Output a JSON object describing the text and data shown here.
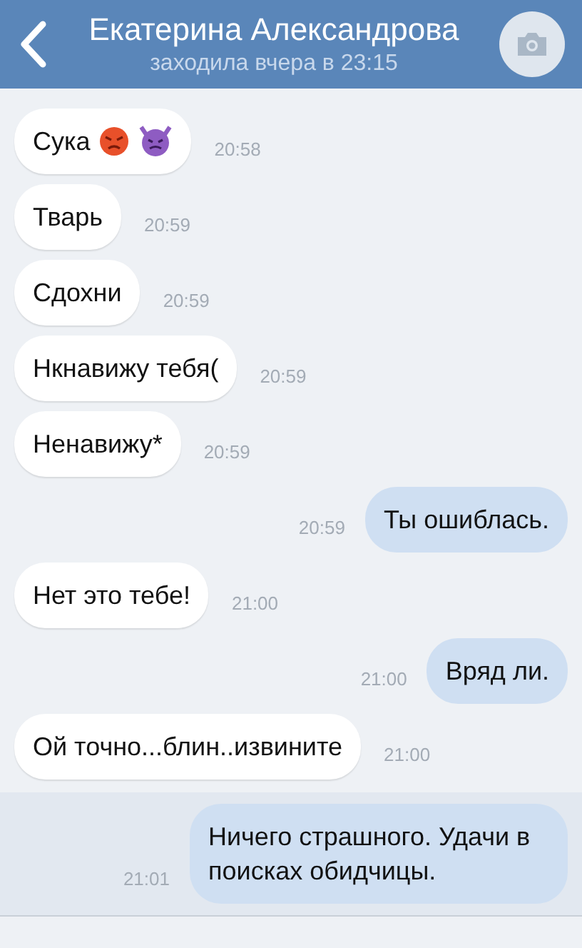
{
  "header": {
    "title": "Екатерина Александрова",
    "status": "заходила вчера в 23:15"
  },
  "messages": [
    {
      "kind": "incoming_emoji",
      "text": "Сука",
      "time": "20:58",
      "unread": false
    },
    {
      "kind": "incoming",
      "text": "Тварь",
      "time": "20:59",
      "unread": false
    },
    {
      "kind": "incoming",
      "text": "Сдохни",
      "time": "20:59",
      "unread": false
    },
    {
      "kind": "incoming",
      "text": "Нкнавижу тебя(",
      "time": "20:59",
      "unread": false
    },
    {
      "kind": "incoming",
      "text": "Ненавижу*",
      "time": "20:59",
      "unread": false
    },
    {
      "kind": "outgoing",
      "text": "Ты ошиблась.",
      "time": "20:59",
      "unread": false
    },
    {
      "kind": "incoming",
      "text": "Нет это тебе!",
      "time": "21:00",
      "unread": false
    },
    {
      "kind": "outgoing",
      "text": "Вряд ли.",
      "time": "21:00",
      "unread": false
    },
    {
      "kind": "incoming",
      "text": "Ой точно...блин..извините",
      "time": "21:00",
      "unread": false
    },
    {
      "kind": "outgoing",
      "text": "Ничего страшного. Удачи в поисках обидчицы.",
      "time": "21:01",
      "unread": true
    }
  ]
}
